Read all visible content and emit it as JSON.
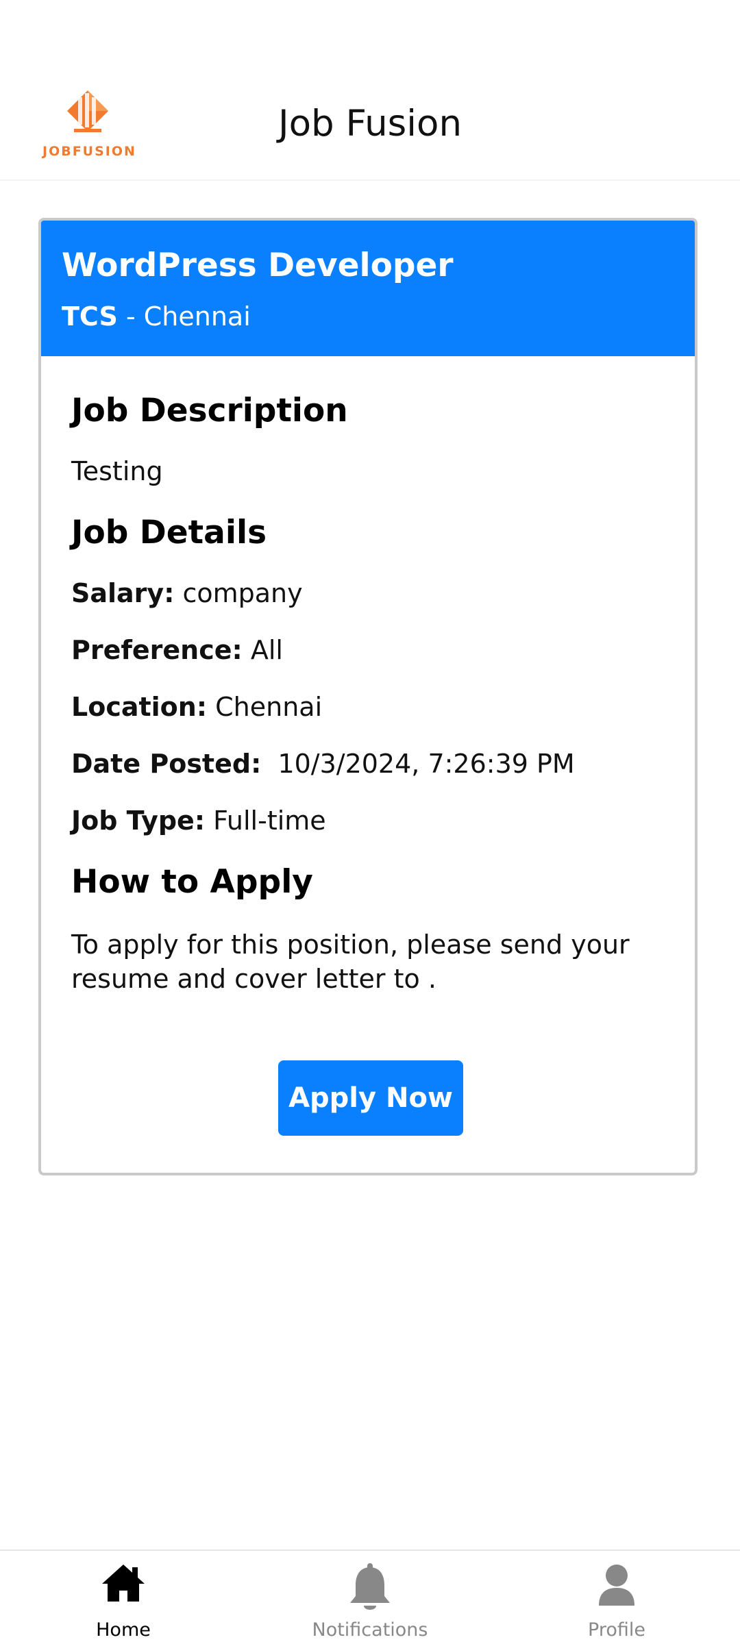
{
  "header": {
    "logo_text": "JOBFUSION",
    "title": "Job Fusion"
  },
  "job": {
    "title": "WordPress Developer",
    "company": "TCS",
    "separator": " - ",
    "location": "Chennai",
    "description_heading": "Job Description",
    "description": "Testing",
    "details_heading": "Job Details",
    "details": [
      {
        "label": "Salary:",
        "value": "company"
      },
      {
        "label": "Preference:",
        "value": "All"
      },
      {
        "label": "Location:",
        "value": "Chennai"
      },
      {
        "label": "Date Posted:",
        "value": " 10/3/2024, 7:26:39 PM"
      },
      {
        "label": "Job Type:",
        "value": "Full-time"
      }
    ],
    "apply_heading": "How to Apply",
    "apply_text": "To apply for this position, please send your resume and cover letter to .",
    "apply_button": "Apply Now"
  },
  "nav": {
    "items": [
      {
        "label": "Home",
        "icon": "home-icon",
        "active": true
      },
      {
        "label": "Notifications",
        "icon": "bell-icon",
        "active": false
      },
      {
        "label": "Profile",
        "icon": "user-icon",
        "active": false
      }
    ]
  },
  "colors": {
    "accent": "#0a80ff",
    "logo": "#f27a2e",
    "inactive": "#888888"
  }
}
